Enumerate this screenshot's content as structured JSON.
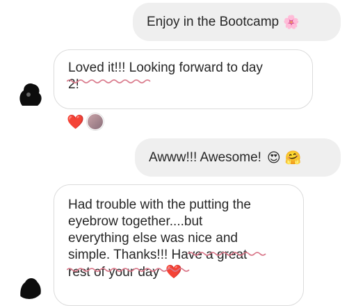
{
  "messages": [
    {
      "sender": "self",
      "text": "Enjoy in the Bootcamp",
      "emoji": "🌸"
    },
    {
      "sender": "other",
      "line1": "Loved it!!! Looking forward to day",
      "line2": "2!",
      "reactions": [
        "heart",
        "reactor-avatar"
      ]
    },
    {
      "sender": "self",
      "text": "Awww!!! Awesome!",
      "emoji": "😍 🤗"
    },
    {
      "sender": "other",
      "lines": [
        "Had trouble with the putting the",
        "eyebrow together....but",
        "everything else was nice and",
        "simple. Thanks!!! Have a great",
        "rest of your day"
      ],
      "emoji": "❤️"
    }
  ],
  "reaction_heart": "❤️",
  "colors": {
    "outgoing_bubble": "#efefef",
    "incoming_border": "#dbdbdb",
    "spell_underline": "#d9788a",
    "heart": "#ed4956"
  }
}
